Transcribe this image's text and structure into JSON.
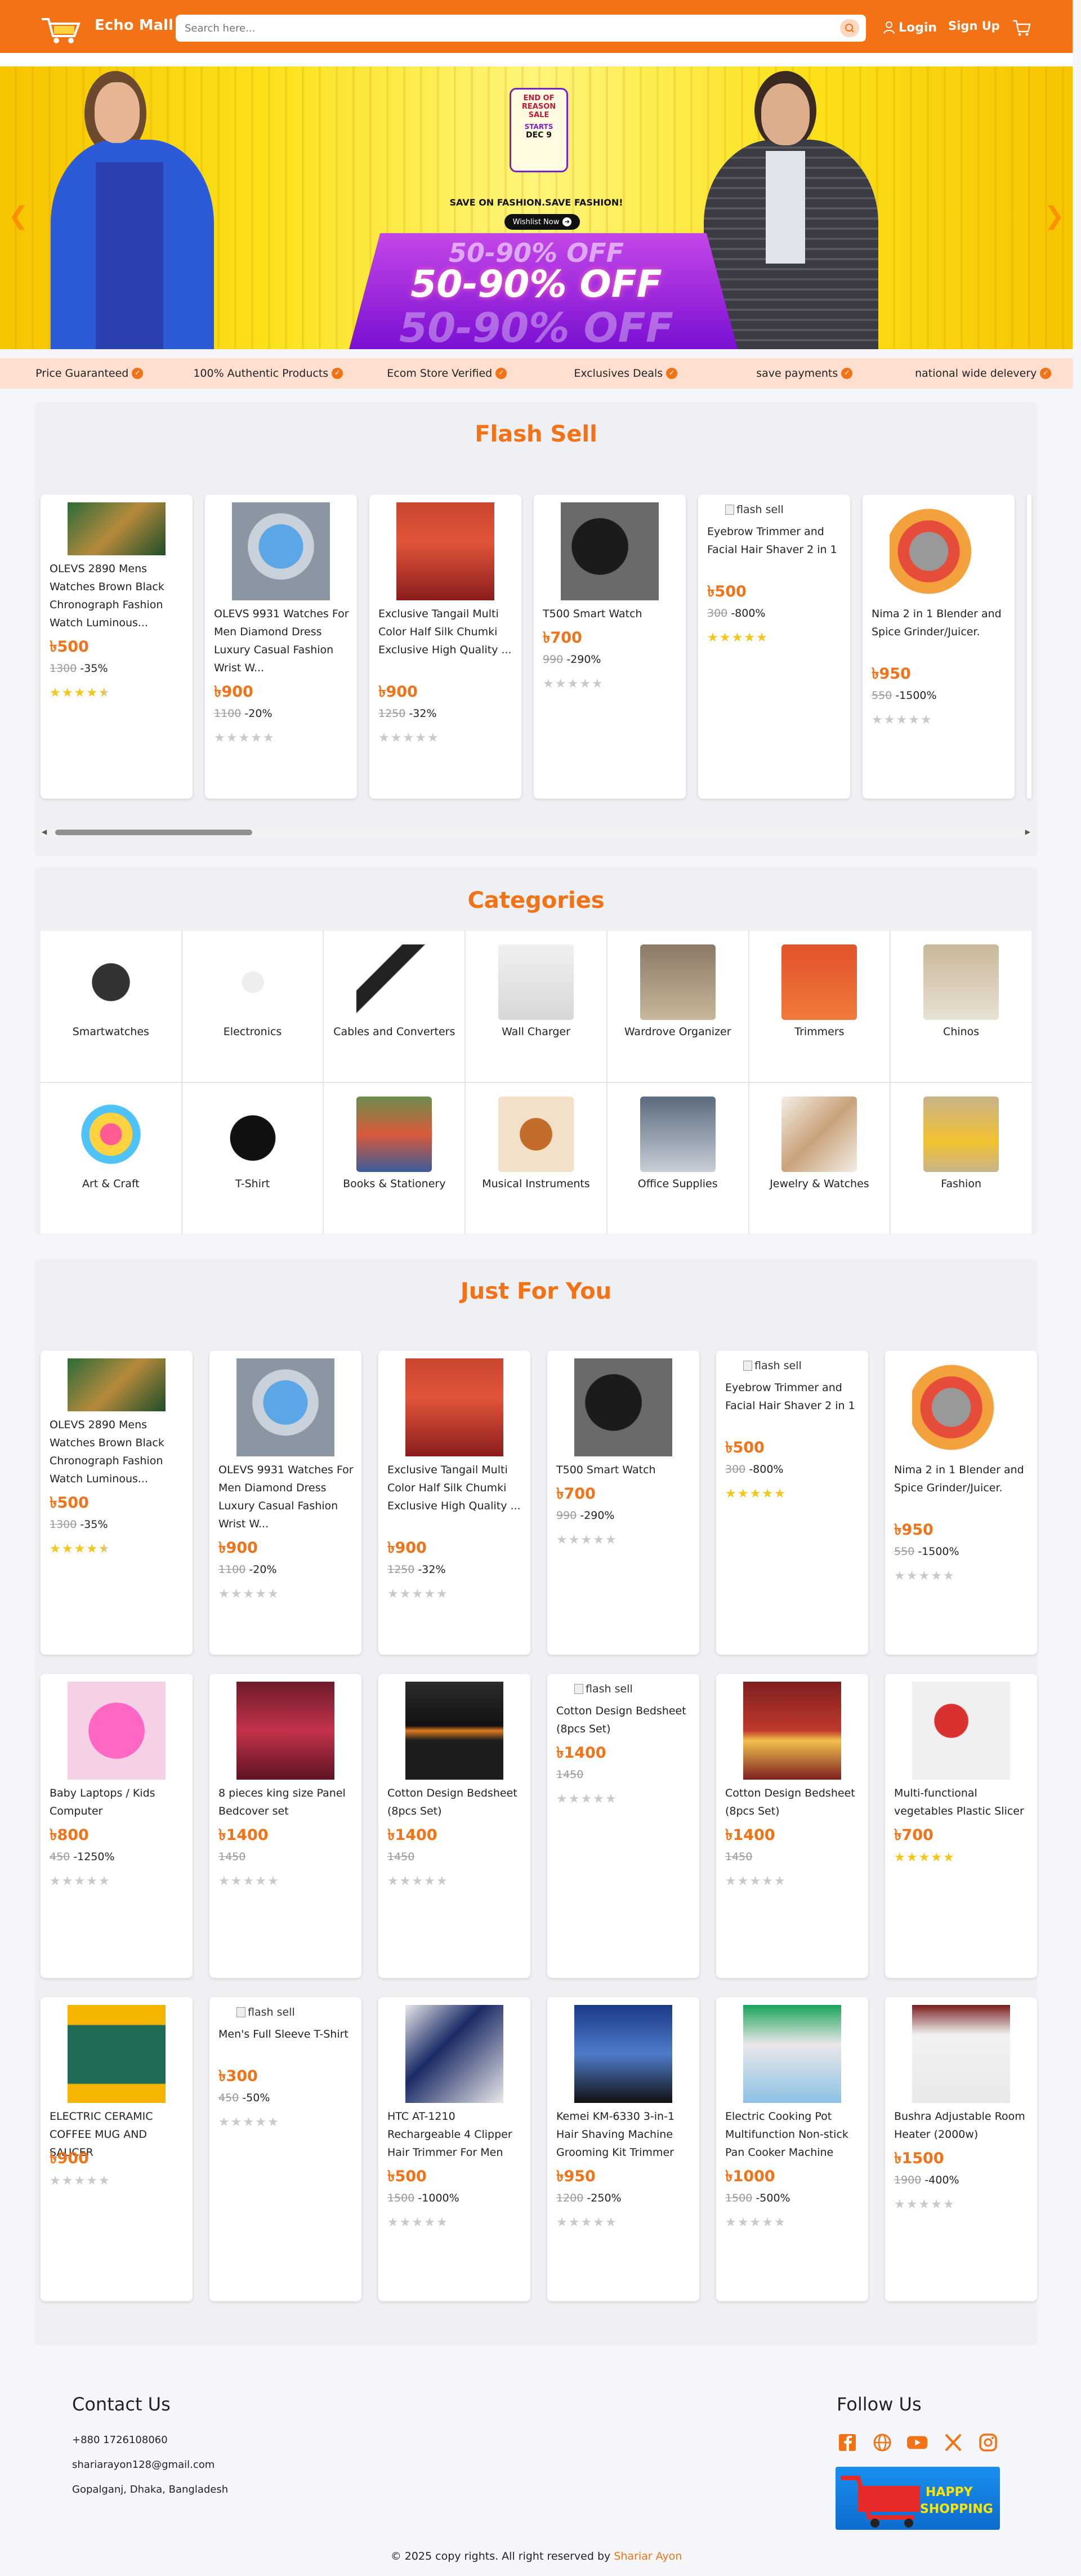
{
  "header": {
    "brand": "Echo Mall",
    "search_placeholder": "Search here...",
    "login": "Login",
    "signup": "Sign Up",
    "accent": "#f47216"
  },
  "banner": {
    "badge_title": "END OF REASON SALE",
    "badge_starts": "STARTS",
    "badge_date": "DEC 9",
    "tagline": "SAVE ON FASHION.SAVE  FASHION!",
    "wishlist": "Wishlist Now",
    "offer": "50-90% OFF"
  },
  "features": [
    {
      "label": "Price Guaranteed",
      "icon": "check-icon"
    },
    {
      "label": "100% Authentic Products",
      "icon": "check-icon"
    },
    {
      "label": "Ecom Store Verified",
      "icon": "flame-icon"
    },
    {
      "label": "Exclusives Deals",
      "icon": "shield-icon"
    },
    {
      "label": "save payments",
      "icon": "truck-icon"
    },
    {
      "label": "national wide delevery",
      "icon": "leaf-icon"
    }
  ],
  "flash_sell": {
    "title": "Flash Sell",
    "products": [
      {
        "name": "OLEVS 2890 Mens Watches Brown Black Chronograph Fashion Watch Luminous...",
        "price": "৳500",
        "old": "1300",
        "disc": "-35%",
        "stars": 4.5
      },
      {
        "name": "OLEVS 9931 Watches For Men Diamond Dress Luxury Casual Fashion Wrist W...",
        "price": "৳900",
        "old": "1100",
        "disc": "-20%",
        "stars": 0
      },
      {
        "name": "Exclusive Tangail Multi Color Half Silk Chumki Exclusive High Quality ...",
        "price": "৳900",
        "old": "1250",
        "disc": "-32%",
        "stars": 0
      },
      {
        "name": "T500 Smart Watch",
        "price": "৳700",
        "old": "990",
        "disc": "-290%",
        "stars": 0
      },
      {
        "name": "Eyebrow Trimmer and Facial Hair Shaver 2 in 1",
        "price": "৳500",
        "old": "300",
        "disc": "-800%",
        "stars": 5,
        "broken_alt": "flash sell"
      },
      {
        "name": "Nima 2 in 1 Blender and Spice Grinder/Juicer.",
        "price": "৳950",
        "old": "550",
        "disc": "-1500%",
        "stars": 0
      }
    ]
  },
  "categories": {
    "title": "Categories",
    "items": [
      "Smartwatches",
      "Electronics",
      "Cables and Converters",
      "Wall Charger",
      "Wardrove Organizer",
      "Trimmers",
      "Chinos",
      "Art & Craft",
      "T-Shirt",
      "Books & Stationery",
      "Musical Instruments",
      "Office Supplies",
      "Jewelry & Watches",
      "Fashion"
    ]
  },
  "just_for_you": {
    "title": "Just For You",
    "row1": [
      {
        "name": "OLEVS 2890 Mens Watches Brown Black Chronograph Fashion Watch Luminous...",
        "price": "৳500",
        "old": "1300",
        "disc": "-35%",
        "stars": 4.5
      },
      {
        "name": "OLEVS 9931 Watches For Men Diamond Dress Luxury Casual Fashion Wrist W...",
        "price": "৳900",
        "old": "1100",
        "disc": "-20%",
        "stars": 0
      },
      {
        "name": "Exclusive Tangail Multi Color Half Silk Chumki Exclusive High Quality ...",
        "price": "৳900",
        "old": "1250",
        "disc": "-32%",
        "stars": 0
      },
      {
        "name": "T500 Smart Watch",
        "price": "৳700",
        "old": "990",
        "disc": "-290%",
        "stars": 0
      },
      {
        "name": "Eyebrow Trimmer and Facial Hair Shaver 2 in 1",
        "price": "৳500",
        "old": "300",
        "disc": "-800%",
        "stars": 5,
        "broken_alt": "flash sell"
      },
      {
        "name": "Nima 2 in 1 Blender and Spice Grinder/Juicer.",
        "price": "৳950",
        "old": "550",
        "disc": "-1500%",
        "stars": 0
      }
    ],
    "row2": [
      {
        "name": "Baby Laptops / Kids Computer",
        "price": "৳800",
        "old": "450",
        "disc": "-1250%",
        "stars": 0
      },
      {
        "name": "8 pieces king size Panel Bedcover set",
        "price": "৳1400",
        "old": "1450",
        "disc": "",
        "stars": 0
      },
      {
        "name": "Cotton Design Bedsheet (8pcs Set)",
        "price": "৳1400",
        "old": "1450",
        "disc": "",
        "stars": 0
      },
      {
        "name": "Cotton Design Bedsheet (8pcs Set)",
        "price": "৳1400",
        "old": "1450",
        "disc": "",
        "stars": 0,
        "broken_alt": "flash sell"
      },
      {
        "name": "Cotton Design Bedsheet (8pcs Set)",
        "price": "৳1400",
        "old": "1450",
        "disc": "",
        "stars": 0
      },
      {
        "name": "Multi-functional vegetables Plastic Slicer",
        "price": "৳700",
        "old": "",
        "disc": "",
        "stars": 5
      }
    ],
    "row3": [
      {
        "name": "ELECTRIC CERAMIC COFFEE MUG AND SAUCER",
        "price": "৳900",
        "old": "",
        "disc": "",
        "stars": 0
      },
      {
        "name": "Men's Full Sleeve T-Shirt",
        "price": "৳300",
        "old": "450",
        "disc": "-50%",
        "stars": 0,
        "broken_alt": "flash sell"
      },
      {
        "name": "HTC AT-1210 Rechargeable 4 Clipper Hair Trimmer For Men",
        "price": "৳500",
        "old": "1500",
        "disc": "-1000%",
        "stars": 0
      },
      {
        "name": "Kemei KM-6330 3-in-1 Hair Shaving Machine Grooming Kit Trimmer",
        "price": "৳950",
        "old": "1200",
        "disc": "-250%",
        "stars": 0
      },
      {
        "name": "Electric Cooking Pot Multifunction Non-stick Pan Cooker Machine",
        "price": "৳1000",
        "old": "1500",
        "disc": "-500%",
        "stars": 0
      },
      {
        "name": "Bushra Adjustable Room Heater (2000w)",
        "price": "৳1500",
        "old": "1900",
        "disc": "-400%",
        "stars": 0
      }
    ]
  },
  "footer": {
    "contact_title": "Contact Us",
    "phone": "+880 1726108060",
    "email": "shariarayon128@gmail.com",
    "address": "Gopalganj, Dhaka, Bangladesh",
    "follow_title": "Follow Us",
    "happy": "HAPPY SHOPPING",
    "copyright": "© 2025 copy rights. All right reserved by",
    "author": "Shariar Ayon"
  }
}
